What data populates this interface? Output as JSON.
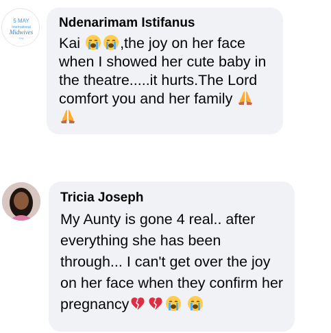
{
  "comments": [
    {
      "author": "Ndenarimam Istifanus",
      "avatar_caption": "5 MAY\nInternational\nMidwives",
      "text_segments": [
        "Kai ",
        ",the joy on her face when I showed her cute baby in the theatre.....it hurts.The Lord comfort you and her family "
      ],
      "emojis": [
        "crying-face",
        "crying-face",
        "folded-hands",
        "folded-hands"
      ]
    },
    {
      "author": "Tricia Joseph",
      "text_segments": [
        "My Aunty is gone 4 real.. after everything she has been through... I can't get over the joy on her face when they confirm her pregnancy"
      ],
      "emojis": [
        "broken-heart",
        "broken-heart",
        "crying-face",
        "crying-face"
      ]
    }
  ],
  "colors": {
    "bubble": "#f0f2f5",
    "text": "#050505"
  }
}
